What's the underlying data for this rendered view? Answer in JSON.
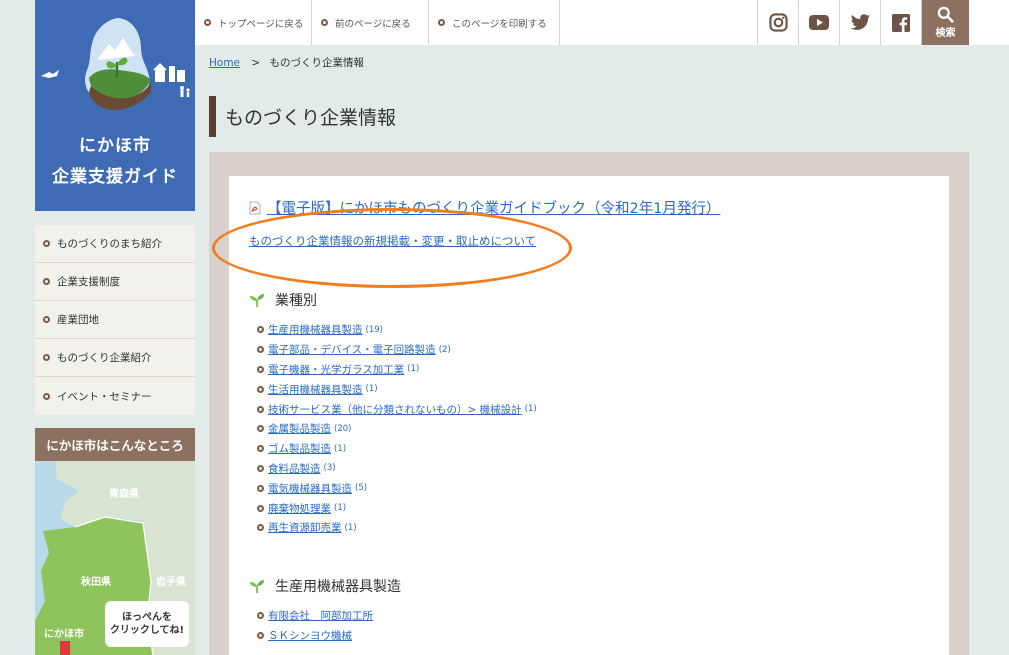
{
  "top_links": [
    {
      "label": "トップページに戻る"
    },
    {
      "label": "前のページに戻る"
    },
    {
      "label": "このページを印刷する"
    }
  ],
  "social": [
    "instagram-icon",
    "youtube-icon",
    "twitter-icon",
    "facebook-icon"
  ],
  "search": {
    "label": "検索"
  },
  "logo": {
    "line1": "にかほ市",
    "line2": "企業支援ガイド"
  },
  "sidebar": {
    "items": [
      {
        "label": "ものづくりのまち紹介"
      },
      {
        "label": "企業支援制度"
      },
      {
        "label": "産業団地"
      },
      {
        "label": "ものづくり企業紹介"
      },
      {
        "label": "イベント・セミナー"
      }
    ],
    "map_title": "にかほ市はこんなところ",
    "map_labels": {
      "aomori": "青森県",
      "akita": "秋田県",
      "iwate": "岩手県",
      "nikaho": "にかほ市"
    },
    "map_bubble": {
      "line1": "ほっぺんを",
      "line2": "クリックしてね!"
    }
  },
  "breadcrumb": {
    "home": "Home",
    "sep": ">",
    "current": "ものづくり企業情報"
  },
  "page_title": "ものづくり企業情報",
  "pdf_link": "【電子版】にかほ市ものづくり企業ガイドブック（令和2年1月発行）",
  "notice_link": "ものづくり企業情報の新規掲載・変更・取止めについて",
  "section1": {
    "title": "業種別",
    "categories": [
      {
        "label": "生産用機械器具製造",
        "count": "(19)"
      },
      {
        "label": "電子部品・デバイス・電子回路製造",
        "count": "(2)"
      },
      {
        "label": "電子機器・光学ガラス加工業",
        "count": "(1)"
      },
      {
        "label": "生活用機械器具製造",
        "count": "(1)"
      },
      {
        "label": "技術サービス業（他に分類されないもの）> 機械設計",
        "count": "(1)"
      },
      {
        "label": "金属製品製造",
        "count": "(20)"
      },
      {
        "label": "ゴム製品製造",
        "count": "(1)"
      },
      {
        "label": "食料品製造",
        "count": "(3)"
      },
      {
        "label": "電気機械器具製造",
        "count": "(5)"
      },
      {
        "label": "廃棄物処理業",
        "count": "(1)"
      },
      {
        "label": "再生資源卸売業",
        "count": "(1)"
      }
    ]
  },
  "section2": {
    "title": "生産用機械器具製造",
    "companies": [
      {
        "label": "有限会社　阿部加工所"
      },
      {
        "label": "ＳＫシンヨウ機械"
      }
    ]
  },
  "colors": {
    "accent_brown": "#8c7161",
    "logo_blue": "#3f6ab4",
    "link_blue": "#2a6bc4",
    "highlight_orange": "#f07d1e"
  }
}
